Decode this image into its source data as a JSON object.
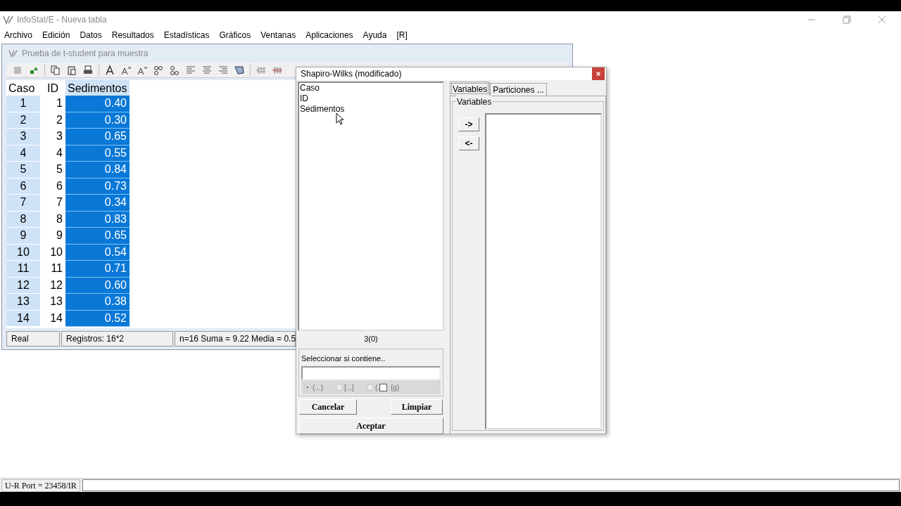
{
  "window": {
    "title": "InfoStat/E - Nueva tabla"
  },
  "menu": [
    "Archivo",
    "Edición",
    "Datos",
    "Resultados",
    "Estadísticas",
    "Gráficos",
    "Ventanas",
    "Aplicaciones",
    "Ayuda",
    "[R]"
  ],
  "child_window": {
    "title": "Prueba de t-student para muestra",
    "table": {
      "columns": [
        {
          "label": "Caso",
          "kind": "row_header",
          "selected": false
        },
        {
          "label": "ID",
          "kind": "data",
          "selected": false
        },
        {
          "label": "Sedimentos",
          "kind": "data",
          "selected": true
        }
      ],
      "rows": [
        [
          "1",
          "1",
          "0.40"
        ],
        [
          "2",
          "2",
          "0.30"
        ],
        [
          "3",
          "3",
          "0.65"
        ],
        [
          "4",
          "4",
          "0.55"
        ],
        [
          "5",
          "5",
          "0.84"
        ],
        [
          "6",
          "6",
          "0.73"
        ],
        [
          "7",
          "7",
          "0.34"
        ],
        [
          "8",
          "8",
          "0.83"
        ],
        [
          "9",
          "9",
          "0.65"
        ],
        [
          "10",
          "10",
          "0.54"
        ],
        [
          "11",
          "11",
          "0.71"
        ],
        [
          "12",
          "12",
          "0.60"
        ],
        [
          "13",
          "13",
          "0.38"
        ],
        [
          "14",
          "14",
          "0.52"
        ]
      ]
    },
    "status": [
      "Real",
      "Registros: 16*2",
      "n=16   Suma = 9.22   Media = 0.5"
    ]
  },
  "dialog": {
    "title": "Shapiro-Wilks (modificado)",
    "source_list": [
      "Caso",
      "ID",
      "Sedimentos"
    ],
    "count": "3(0)",
    "filter": {
      "label": "Seleccionar si contiene..",
      "disabled": true,
      "options": [
        {
          "label": "(...)",
          "selected": true
        },
        {
          "label": "[...]",
          "selected": false
        },
        {
          "label": "(.",
          "selected": false
        }
      ],
      "checkbox": {
        "label": "{g}",
        "checked": false
      }
    },
    "buttons": {
      "cancel": "Cancelar",
      "clear": "Limpiar",
      "ok": "Aceptar"
    },
    "tabs": [
      {
        "label": "Variables",
        "selected": true
      },
      {
        "label": "Particiones ...",
        "selected": false
      }
    ],
    "variables_group": "Variables",
    "move_buttons": [
      "->",
      "<-"
    ]
  },
  "status_bar": {
    "port": "U-R Port = 23458/IR"
  }
}
